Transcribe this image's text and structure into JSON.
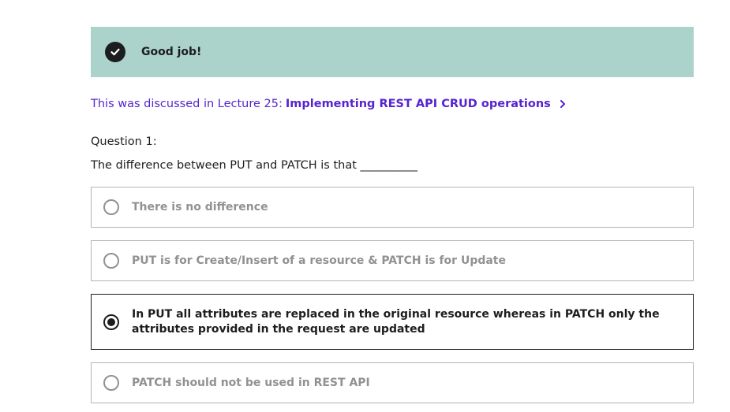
{
  "feedback": {
    "message": "Good job!",
    "icon": "check-circle-icon"
  },
  "lecture": {
    "prefix": "This was discussed in Lecture 25:",
    "link_text": "Implementing REST API CRUD operations",
    "icon": "chevron-right-icon"
  },
  "question": {
    "number_label": "Question 1:",
    "text": "The difference between PUT and PATCH is that __________"
  },
  "options": [
    {
      "label": "There is no difference",
      "selected": false
    },
    {
      "label": "PUT is for Create/Insert of a resource & PATCH is for Update",
      "selected": false
    },
    {
      "label": "In PUT all attributes are replaced in the original resource whereas in PATCH only the attributes provided in the request are updated",
      "selected": true
    },
    {
      "label": "PATCH should not be used in REST API",
      "selected": false
    }
  ],
  "colors": {
    "banner_bg": "#acd2cc",
    "link": "#5624d0",
    "text": "#1c1d1f",
    "muted": "#8f9193"
  }
}
